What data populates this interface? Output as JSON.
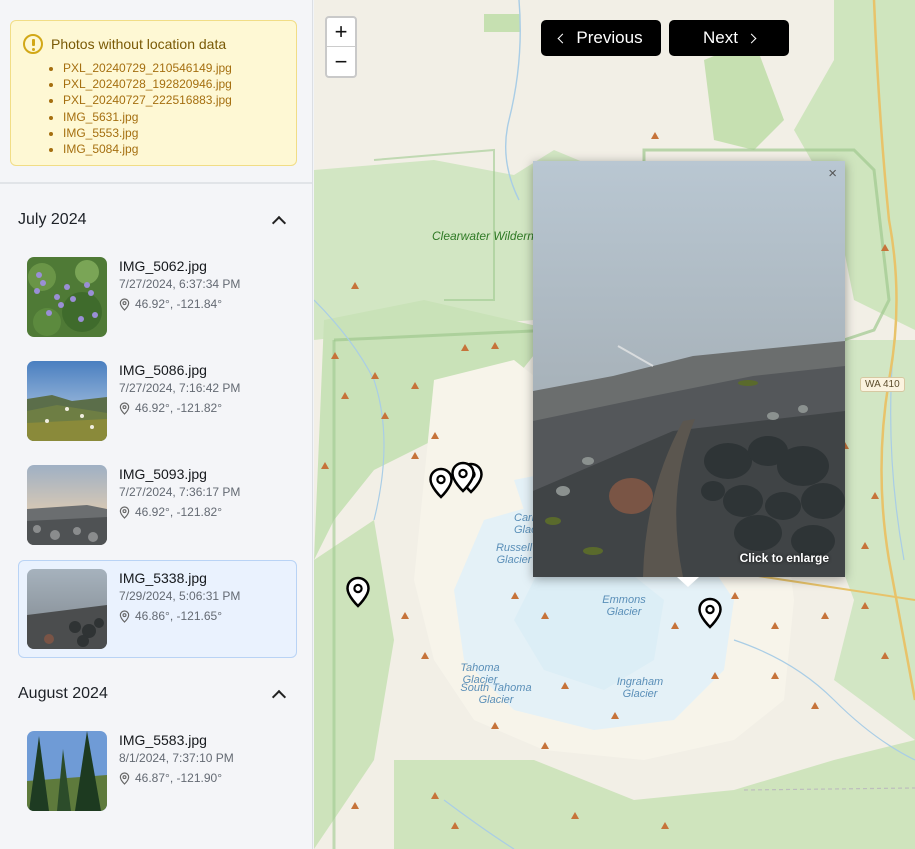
{
  "no_location": {
    "title": "Photos without location data",
    "files": [
      "PXL_20240729_210546149.jpg",
      "PXL_20240728_192820946.jpg",
      "PXL_20240727_222516883.jpg",
      "IMG_5631.jpg",
      "IMG_5553.jpg",
      "IMG_5084.jpg"
    ]
  },
  "groups": [
    {
      "title": "July 2024",
      "photos": [
        {
          "name": "IMG_5062.jpg",
          "date": "7/27/2024, 6:37:34 PM",
          "coords": "46.92°, -121.84°"
        },
        {
          "name": "IMG_5086.jpg",
          "date": "7/27/2024, 7:16:42 PM",
          "coords": "46.92°, -121.82°"
        },
        {
          "name": "IMG_5093.jpg",
          "date": "7/27/2024, 7:36:17 PM",
          "coords": "46.92°, -121.82°"
        },
        {
          "name": "IMG_5338.jpg",
          "date": "7/29/2024, 5:06:31 PM",
          "coords": "46.86°, -121.65°"
        }
      ]
    },
    {
      "title": "August 2024",
      "photos": [
        {
          "name": "IMG_5583.jpg",
          "date": "8/1/2024, 7:37:10 PM",
          "coords": "46.87°, -121.90°"
        }
      ]
    }
  ],
  "map": {
    "zoom_in": "+",
    "zoom_out": "−",
    "prev_label": "Previous",
    "next_label": "Next",
    "popup": {
      "close": "×",
      "enlarge": "Click to enlarge"
    },
    "labels": {
      "clearwater": "Clearwater Wilderness",
      "russell": "Russell Glacier",
      "carbon": "Carb Glac",
      "emmons": "Emmons Glacier",
      "tahoma": "Tahoma Glacier",
      "south_tahoma": "South Tahoma Glacier",
      "ingraham": "Ingraham Glacier",
      "wa410": "WA 410"
    }
  },
  "icons": {
    "warning": "warning-circle-icon",
    "chevron_up": "chevron-up-icon",
    "location": "location-pin-icon",
    "prev": "chevron-left-icon",
    "next": "chevron-right-icon",
    "close": "close-icon"
  },
  "colors": {
    "warning_bg": "#fef8d4",
    "selected_bg": "#eaf2fe",
    "button_bg": "#000000",
    "forest": "#cfe5bf",
    "glacier": "#e6f2f7",
    "peak": "#c6733a"
  }
}
